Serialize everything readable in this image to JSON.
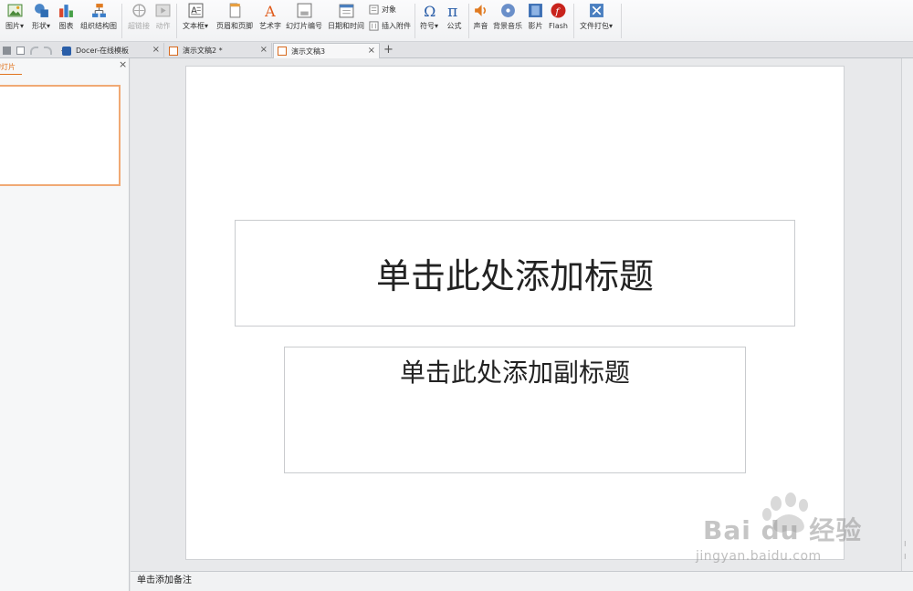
{
  "ribbon": {
    "picture": "图片",
    "shape": "形状",
    "chart": "图表",
    "org_chart": "组织结构图",
    "hyperlink": "超链接",
    "action": "动作",
    "textbox": "文本框",
    "header_footer": "页眉和页脚",
    "wordart": "艺术字",
    "slide_number": "幻灯片编号",
    "date_time": "日期和时间",
    "object": "对象",
    "attachment": "插入附件",
    "symbol": "符号",
    "formula": "公式",
    "sound": "声音",
    "bg_music": "背景音乐",
    "movie": "影片",
    "flash": "Flash",
    "file_pack": "文件打包",
    "dropdown_arrow": "▾"
  },
  "tabs": [
    {
      "label": "Docer-在线模板",
      "close": "×"
    },
    {
      "label": "演示文稿2 *",
      "close": "×"
    },
    {
      "label": "演示文稿3",
      "close": "×"
    }
  ],
  "new_tab": "+",
  "panel": {
    "title": "幻灯片",
    "title_visible": "幻灯片",
    "close": "×"
  },
  "slide": {
    "title_placeholder": "单击此处添加标题",
    "subtitle_placeholder": "单击此处添加副标题"
  },
  "notes": {
    "placeholder": "单击添加备注"
  },
  "watermark": {
    "brand": "Bai du 经验",
    "url": "jingyan.baidu.com"
  },
  "colors": {
    "accent": "#e0731e",
    "thumb_border": "#f0a974"
  }
}
